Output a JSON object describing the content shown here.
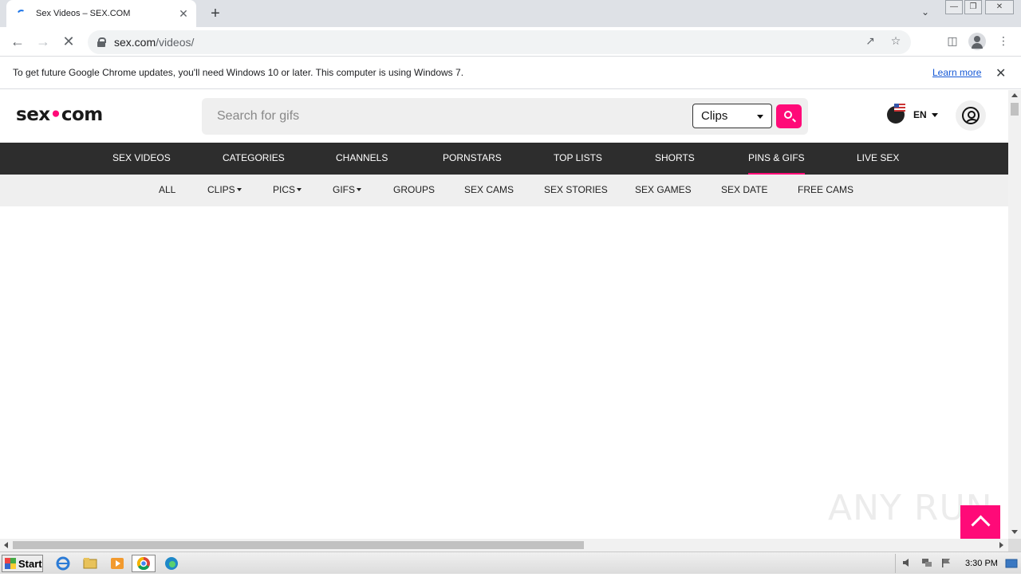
{
  "browser": {
    "tab_title": "Sex Videos – SEX.COM",
    "tab_close": "✕",
    "new_tab": "+",
    "url_host": "sex.com",
    "url_path": "/videos/",
    "infobar_message": "To get future Google Chrome updates, you'll need Windows 10 or later. This computer is using Windows 7.",
    "infobar_link": "Learn more",
    "infobar_close": "✕"
  },
  "site": {
    "logo_left": "sex",
    "logo_dot": "•",
    "logo_right": "com",
    "search_placeholder": "Search for gifs",
    "search_scope": "Clips",
    "language": "EN"
  },
  "main_nav": [
    {
      "label": "SEX VIDEOS"
    },
    {
      "label": "CATEGORIES"
    },
    {
      "label": "CHANNELS"
    },
    {
      "label": "PORNSTARS"
    },
    {
      "label": "TOP LISTS"
    },
    {
      "label": "SHORTS"
    },
    {
      "label": "PINS & GIFS",
      "active": true
    },
    {
      "label": "LIVE SEX"
    }
  ],
  "sub_nav": [
    {
      "label": "ALL"
    },
    {
      "label": "CLIPS",
      "dropdown": true
    },
    {
      "label": "PICS",
      "dropdown": true
    },
    {
      "label": "GIFS",
      "dropdown": true
    },
    {
      "label": "GROUPS"
    },
    {
      "label": "SEX CAMS"
    },
    {
      "label": "SEX STORIES"
    },
    {
      "label": "SEX GAMES"
    },
    {
      "label": "SEX DATE"
    },
    {
      "label": "FREE CAMS"
    }
  ],
  "watermark": "ANY RUN",
  "taskbar": {
    "start_label": "Start",
    "clock": "3:30 PM"
  },
  "colors": {
    "accent": "#ff0a78",
    "nav_bg": "#2d2d2d",
    "subnav_bg": "#efefef"
  },
  "icons": [
    "favicon-icon",
    "back-arrow-icon",
    "forward-arrow-icon",
    "reload-stop-icon",
    "lock-icon",
    "share-icon",
    "star-icon",
    "sidepanel-icon",
    "profile-icon",
    "menu-dots-icon",
    "search-icon",
    "globe-flag-icon",
    "user-account-icon",
    "chevron-up-icon"
  ]
}
